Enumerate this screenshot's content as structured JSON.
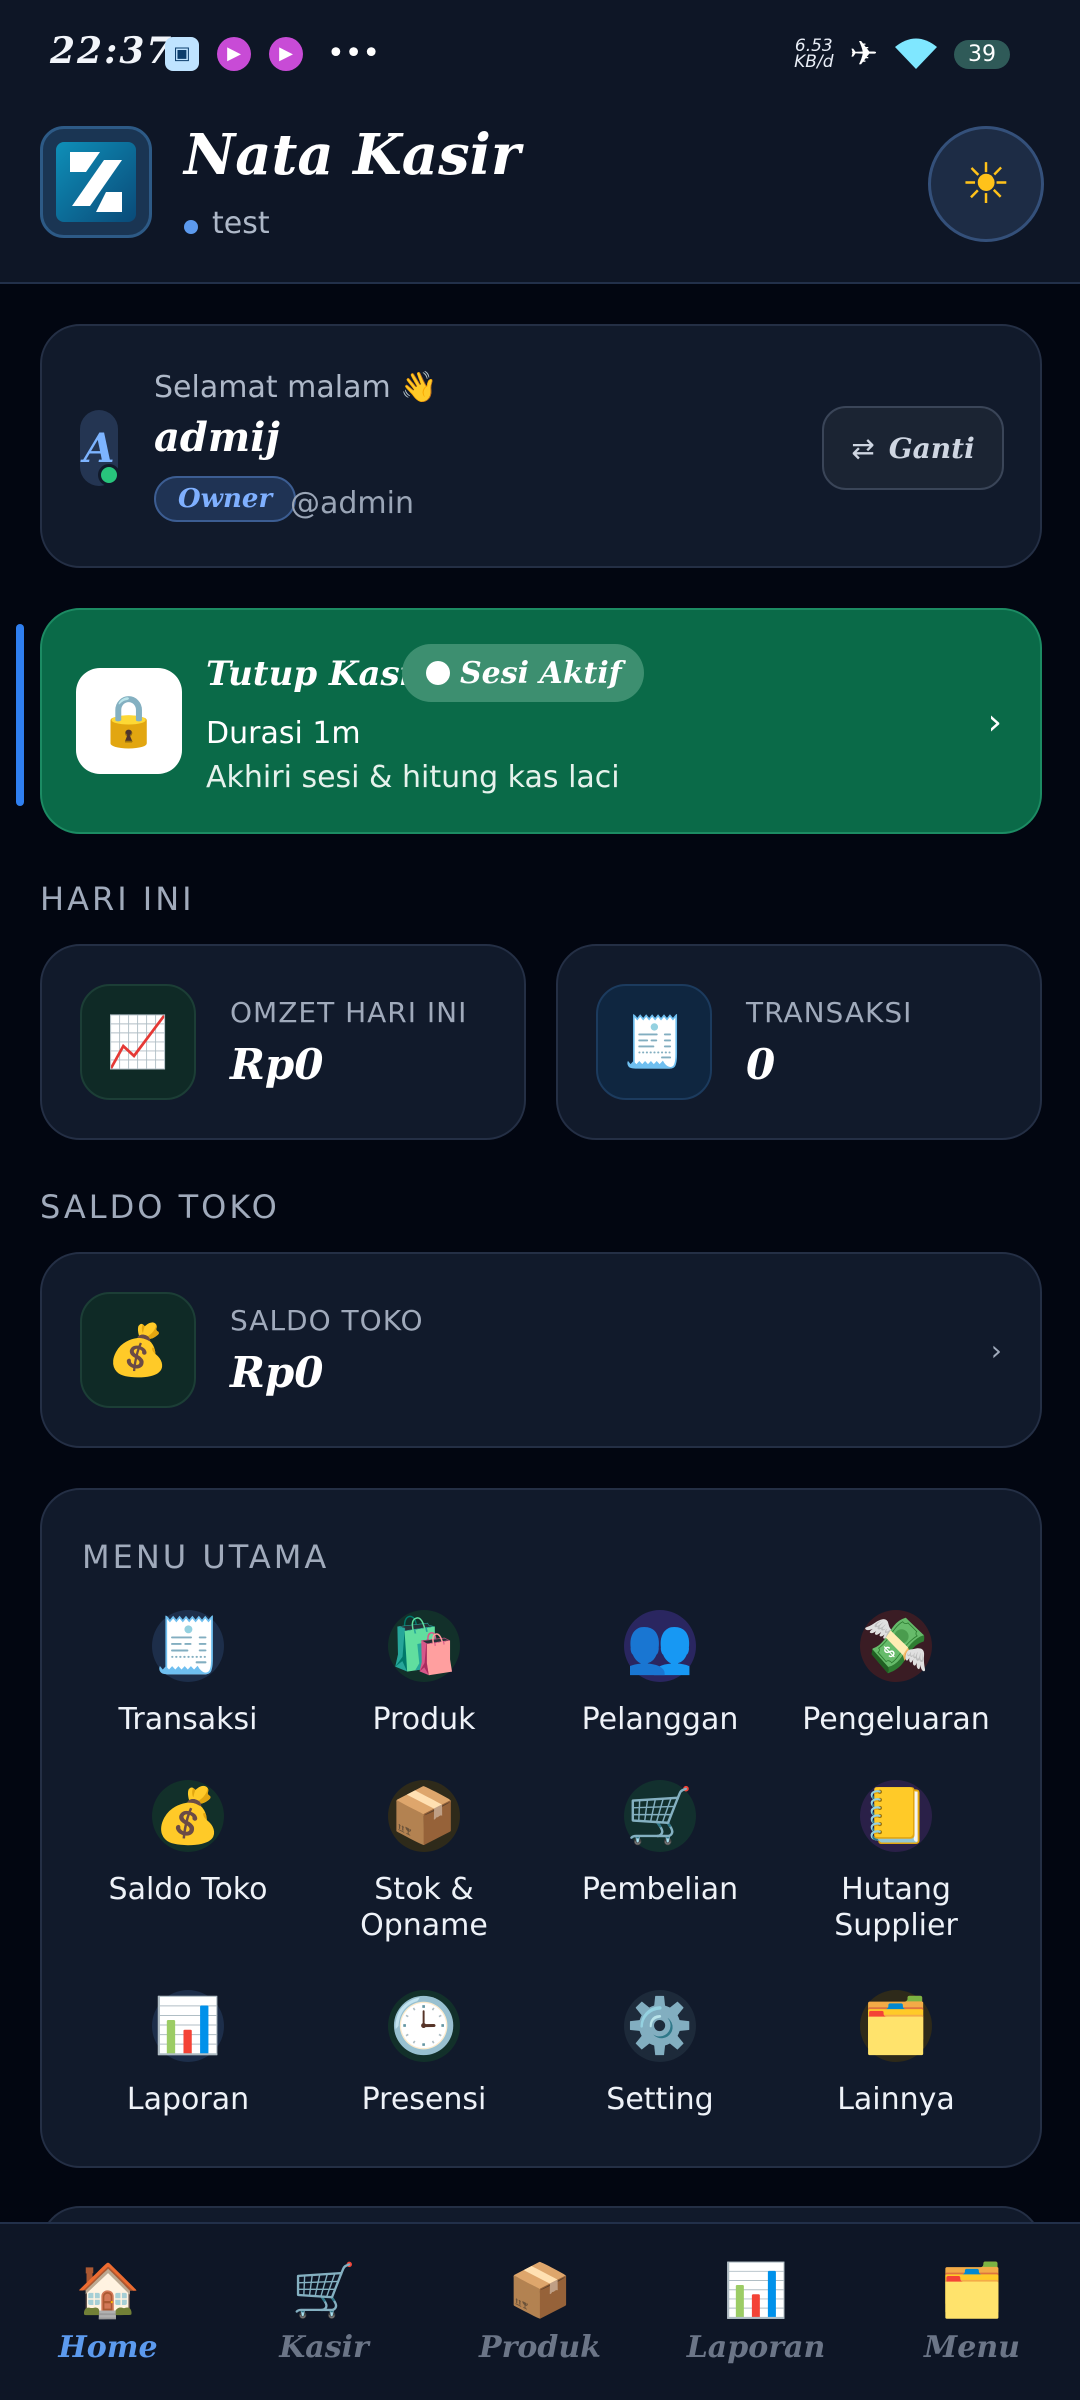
{
  "status_bar": {
    "time": "22:37",
    "net_speed_top": "6.53",
    "net_speed_bottom": "KB/d",
    "battery": "39"
  },
  "header": {
    "app_title": "Nata Kasir",
    "store_name": "test"
  },
  "user_card": {
    "greeting": "Selamat malam 👋",
    "avatar_letter": "A",
    "name": "admij",
    "role": "Owner",
    "handle": "@admin",
    "switch_label": "Ganti"
  },
  "session": {
    "title": "Tutup Kasir",
    "badge": "Sesi Aktif",
    "duration": "Durasi 1m",
    "description": "Akhiri sesi & hitung kas laci"
  },
  "today": {
    "section_label": "HARI INI",
    "omzet_label": "OMZET HARI INI",
    "omzet_value": "Rp0",
    "transaksi_label": "TRANSAKSI",
    "transaksi_value": "0"
  },
  "saldo": {
    "section_label": "SALDO TOKO",
    "card_label": "SALDO TOKO",
    "card_value": "Rp0"
  },
  "menu": {
    "title": "MENU UTAMA",
    "items": [
      {
        "label": "Transaksi",
        "glyph": "🧾",
        "bg": "#1d2e4a"
      },
      {
        "label": "Produk",
        "glyph": "🛍️",
        "bg": "#12302a"
      },
      {
        "label": "Pelanggan",
        "glyph": "👥",
        "bg": "#2a2660"
      },
      {
        "label": "Pengeluaran",
        "glyph": "💸",
        "bg": "#3a1c24"
      },
      {
        "label": "Saldo Toko",
        "glyph": "💰",
        "bg": "#12302a"
      },
      {
        "label": "Stok & Opname",
        "glyph": "📦",
        "bg": "#2e2a1a"
      },
      {
        "label": "Pembelian",
        "glyph": "🛒",
        "bg": "#12302e"
      },
      {
        "label": "Hutang Supplier",
        "glyph": "📒",
        "bg": "#2a2048"
      },
      {
        "label": "Laporan",
        "glyph": "📊",
        "bg": "#1d2e4a"
      },
      {
        "label": "Presensi",
        "glyph": "🕒",
        "bg": "#12302a"
      },
      {
        "label": "Setting",
        "glyph": "⚙️",
        "bg": "#1d2a3a"
      },
      {
        "label": "Lainnya",
        "glyph": "🗂️",
        "bg": "#2e2a1a"
      }
    ]
  },
  "bottom_nav": {
    "items": [
      {
        "label": "Home",
        "glyph": "🏠"
      },
      {
        "label": "Kasir",
        "glyph": "🛒"
      },
      {
        "label": "Produk",
        "glyph": "📦"
      },
      {
        "label": "Laporan",
        "glyph": "📊"
      },
      {
        "label": "Menu",
        "glyph": "🗂️"
      }
    ]
  }
}
